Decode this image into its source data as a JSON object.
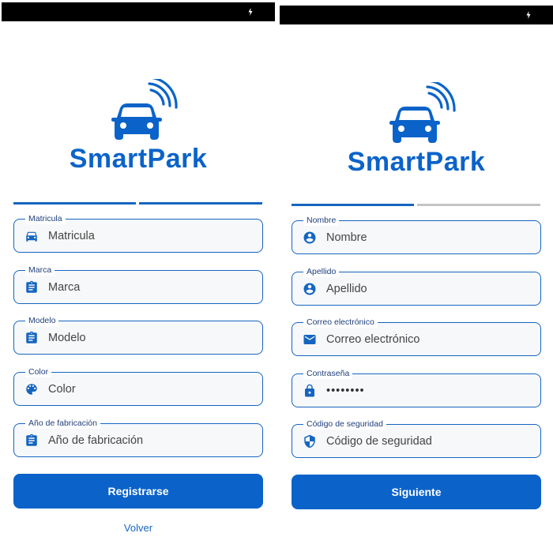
{
  "brand": {
    "name": "SmartPark",
    "color": "#0b63c9"
  },
  "left_screen": {
    "progress": {
      "steps_total": 2,
      "steps_active": 2
    },
    "fields": [
      {
        "label": "Matricula",
        "placeholder": "Matricula",
        "icon": "car-front-icon"
      },
      {
        "label": "Marca",
        "placeholder": "Marca",
        "icon": "clipboard-icon"
      },
      {
        "label": "Modelo",
        "placeholder": "Modelo",
        "icon": "clipboard-icon"
      },
      {
        "label": "Color",
        "placeholder": "Color",
        "icon": "palette-icon"
      },
      {
        "label": "Año de fabricación",
        "placeholder": "Año de fabricación",
        "icon": "clipboard-icon"
      }
    ],
    "primary_button": "Registrarse",
    "secondary_link": "Volver"
  },
  "right_screen": {
    "progress": {
      "steps_total": 2,
      "steps_active": 1
    },
    "fields": [
      {
        "label": "Nombre",
        "placeholder": "Nombre",
        "icon": "account-circle-icon"
      },
      {
        "label": "Apellido",
        "placeholder": "Apellido",
        "icon": "account-circle-icon"
      },
      {
        "label": "Correo electrónico",
        "placeholder": "Correo electrónico",
        "icon": "email-icon"
      },
      {
        "label": "Contraseña",
        "value": "••••••••",
        "icon": "lock-icon"
      },
      {
        "label": "Código de seguridad",
        "placeholder": "Código de seguridad",
        "icon": "security-shield-icon"
      }
    ],
    "primary_button": "Siguiente"
  },
  "colors": {
    "accent": "#1565c0",
    "button": "#0b63c9",
    "inactive_progress": "#c4c4c4"
  }
}
